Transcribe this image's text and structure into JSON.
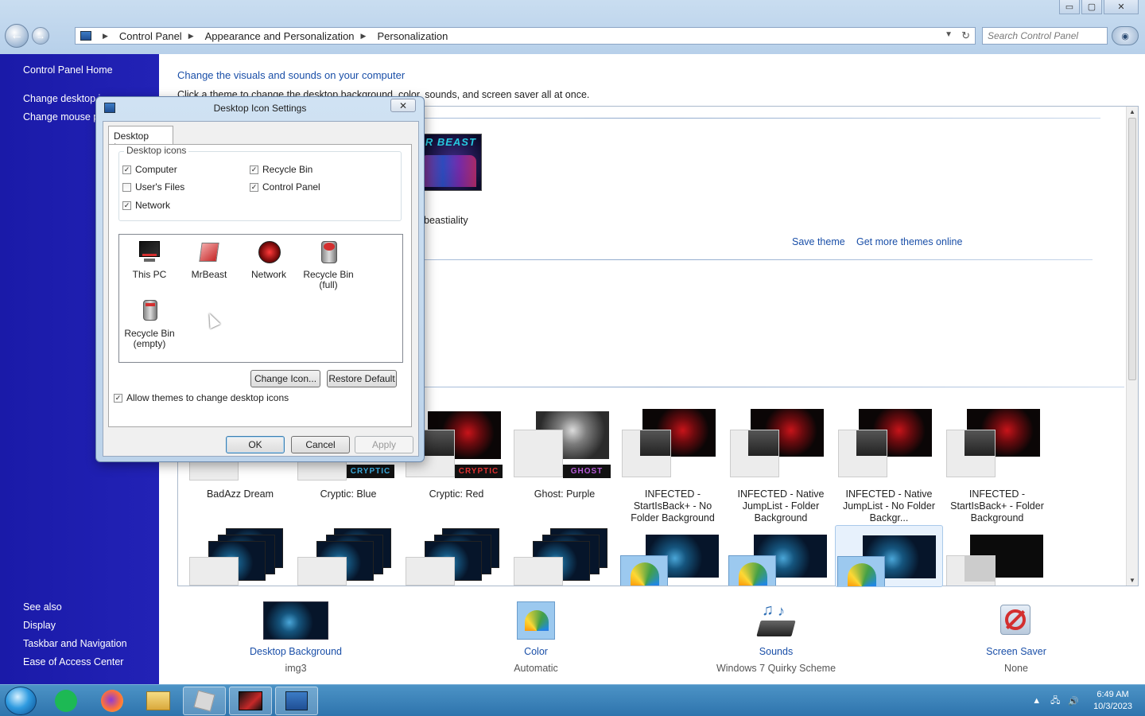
{
  "window": {
    "controls": {
      "minimize": "▭",
      "maximize": "▢",
      "close": "✕"
    }
  },
  "address": {
    "crumbs": [
      "Control Panel",
      "Appearance and Personalization",
      "Personalization"
    ]
  },
  "search": {
    "placeholder": "Search Control Panel"
  },
  "sidebar": {
    "home": "Control Panel Home",
    "links": [
      "Change desktop i",
      "Change mouse p"
    ],
    "see_also_title": "See also",
    "see_also": [
      "Display",
      "Taskbar and Navigation",
      "Ease of Access Center"
    ]
  },
  "main": {
    "heading": "Change the visuals and sounds on your computer",
    "description": "Click a theme to change the desktop background, color, sounds, and screen saver all at once.",
    "my_theme": {
      "name": "mr beastiality",
      "thumb_logo": "MR BEAST"
    },
    "save_theme": "Save theme",
    "get_more": "Get more themes online",
    "themes_row1": [
      {
        "name": "BadAzz Dream",
        "badge": ""
      },
      {
        "name": "Cryptic: Blue",
        "badge": "CRYPTIC"
      },
      {
        "name": "Cryptic: Red",
        "badge": "CRYPTIC"
      },
      {
        "name": "Ghost: Purple",
        "badge": "GHOST"
      },
      {
        "name": "INFECTED - StartIsBack+ - No Folder Background"
      },
      {
        "name": "INFECTED - Native JumpList - Folder Background"
      },
      {
        "name": "INFECTED - Native JumpList - No Folder Backgr..."
      },
      {
        "name": "INFECTED - StartIsBack+ - Folder Background"
      }
    ]
  },
  "bottom": {
    "desktop_background": {
      "label": "Desktop Background",
      "value": "img3"
    },
    "color": {
      "label": "Color",
      "value": "Automatic"
    },
    "sounds": {
      "label": "Sounds",
      "value": "Windows 7 Quirky Scheme"
    },
    "screen_saver": {
      "label": "Screen Saver",
      "value": "None"
    }
  },
  "dialog": {
    "title": "Desktop Icon Settings",
    "tab": "Desktop Icons",
    "group_label": "Desktop icons",
    "checkboxes": {
      "computer": {
        "label": "Computer",
        "checked": true
      },
      "recycle_bin": {
        "label": "Recycle Bin",
        "checked": true
      },
      "users_files": {
        "label": "User's Files",
        "checked": false
      },
      "control_panel": {
        "label": "Control Panel",
        "checked": true
      },
      "network": {
        "label": "Network",
        "checked": true
      }
    },
    "icons": {
      "this_pc": "This PC",
      "mrbeast": "MrBeast",
      "network": "Network",
      "recycle_full": "Recycle Bin (full)",
      "recycle_empty": "Recycle Bin (empty)"
    },
    "change_icon": "Change Icon...",
    "restore_default": "Restore Default",
    "allow_themes": "Allow themes to change desktop icons",
    "ok": "OK",
    "cancel": "Cancel",
    "apply": "Apply"
  },
  "taskbar": {
    "time": "6:49 AM",
    "date": "10/3/2023"
  },
  "colors": {
    "sidebar": "#1f1fb0",
    "link": "#1a4fa8",
    "taskbar": "#3a82ba"
  }
}
